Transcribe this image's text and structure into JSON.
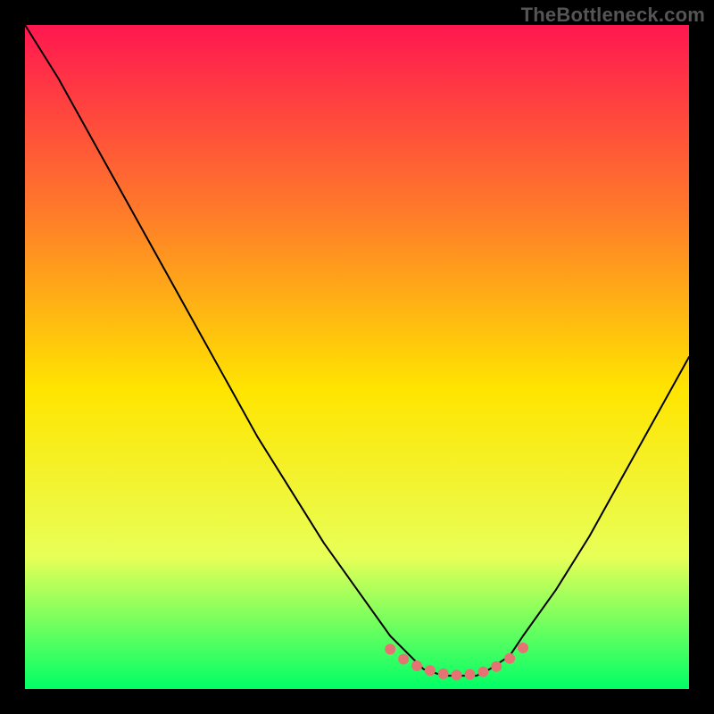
{
  "watermark": "TheBottleneck.com",
  "colors": {
    "gradient_top": "#ff1750",
    "gradient_mid1": "#ff7a2a",
    "gradient_mid2": "#ffe500",
    "gradient_mid3": "#e8ff57",
    "gradient_bottom": "#00ff66",
    "curve": "#000000",
    "dots": "#e57373",
    "frame": "#000000"
  },
  "chart_data": {
    "type": "line",
    "title": "",
    "xlabel": "",
    "ylabel": "",
    "xlim": [
      0,
      100
    ],
    "ylim": [
      0,
      100
    ],
    "x": [
      0,
      5,
      10,
      15,
      20,
      25,
      30,
      35,
      40,
      45,
      50,
      55,
      58,
      60,
      63,
      65,
      68,
      70,
      73,
      75,
      80,
      85,
      90,
      95,
      100
    ],
    "y": [
      100,
      92,
      83,
      74,
      65,
      56,
      47,
      38,
      30,
      22,
      15,
      8,
      5,
      3,
      2,
      2,
      2,
      3,
      5,
      8,
      15,
      23,
      32,
      41,
      50
    ],
    "highlight_points": {
      "x": [
        55,
        57,
        59,
        61,
        63,
        65,
        67,
        69,
        71,
        73,
        75
      ],
      "y": [
        6,
        4.5,
        3.5,
        2.8,
        2.3,
        2.1,
        2.2,
        2.6,
        3.4,
        4.6,
        6.2
      ]
    }
  }
}
